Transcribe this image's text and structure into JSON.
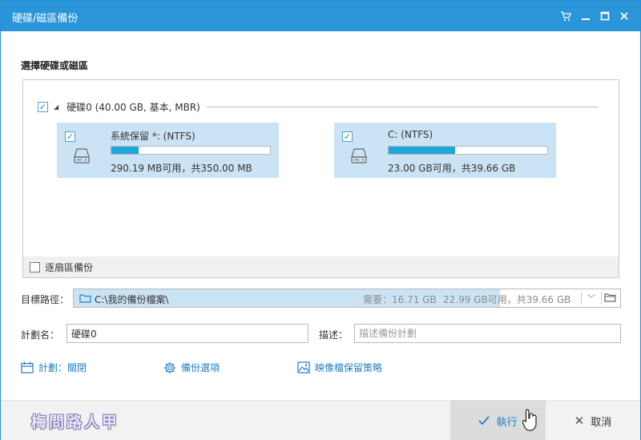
{
  "window": {
    "title": "硬碟/磁區備份",
    "controls": [
      "cart-icon",
      "minimize-icon",
      "maximize-icon",
      "close-icon"
    ]
  },
  "section_title": "選擇硬碟或磁區",
  "disk": {
    "checked": true,
    "label": "硬碟0 (40.00 GB, 基本, MBR)",
    "partitions": [
      {
        "name": "系統保留 *: (NTFS)",
        "usage": "290.19 MB可用，共350.00 MB",
        "used_fraction": 0.17,
        "checked": true
      },
      {
        "name": "C: (NTFS)",
        "usage": "23.00 GB可用，共39.66 GB",
        "used_fraction": 0.42,
        "checked": true
      }
    ]
  },
  "sector_backup": {
    "label": "逐扇區備份",
    "checked": false
  },
  "target": {
    "label": "目標路徑：",
    "path": "C:\\我的備份檔案\\",
    "required": "需要：16.71 GB",
    "free": "22.99 GB可用，共39.66 GB"
  },
  "plan_name": {
    "label": "計劃名：",
    "value": "硬碟0"
  },
  "description": {
    "label": "描述：",
    "placeholder": "描述備份計劃"
  },
  "links": {
    "schedule": "計劃：關閉",
    "backup_options": "備份選項",
    "image_retention": "映像檔保留策略"
  },
  "footer": {
    "watermark": "梅問路人甲",
    "execute": "執行",
    "cancel": "取消"
  },
  "colors": {
    "accent": "#2a95d9",
    "selection": "#cbe4f5",
    "progress": "#1fa6da",
    "link": "#1e7fc4"
  }
}
